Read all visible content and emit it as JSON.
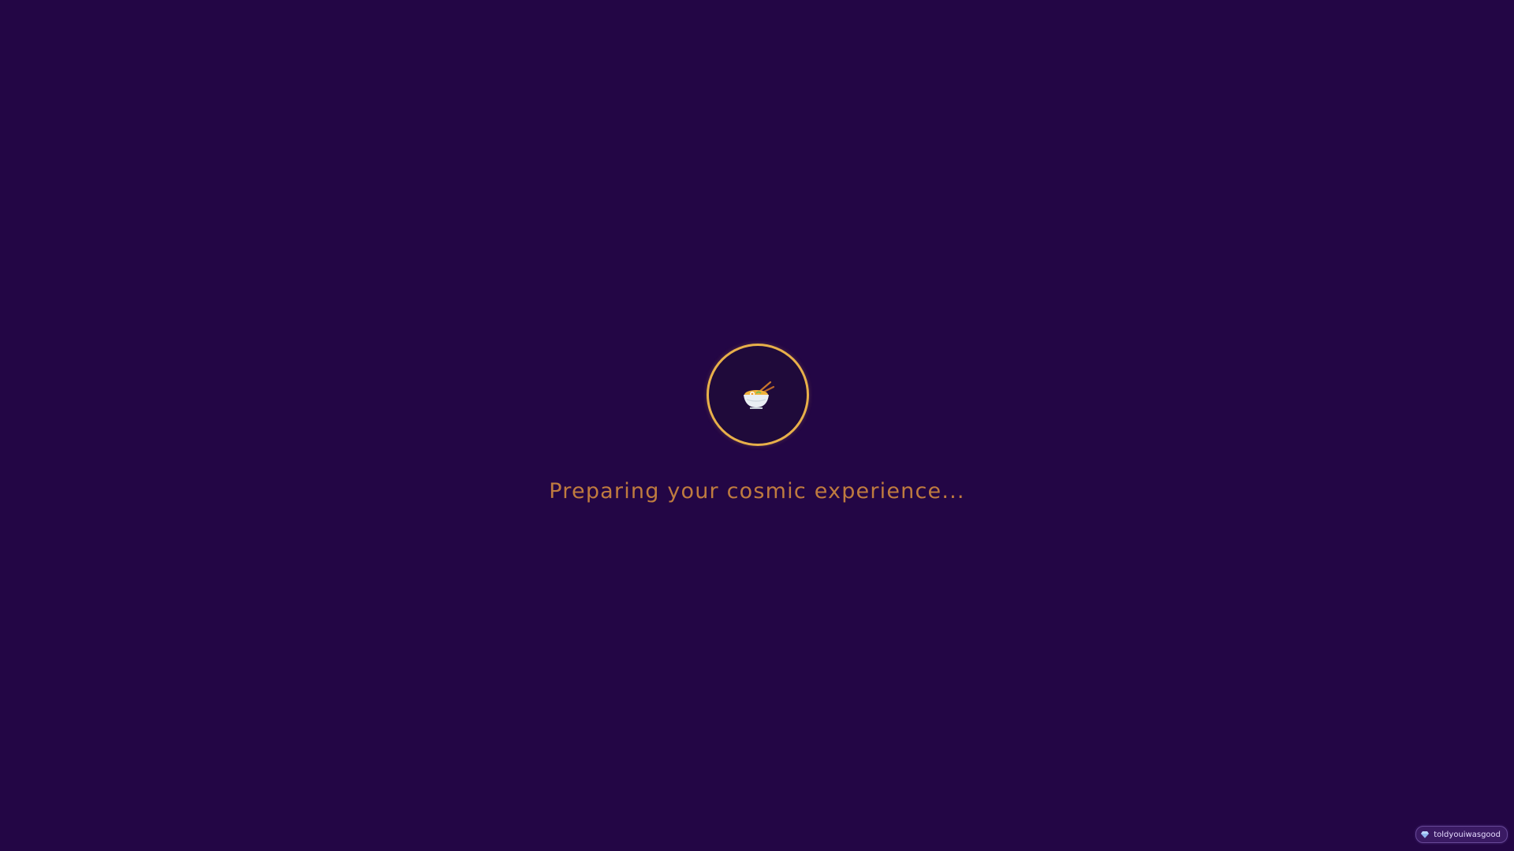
{
  "loader": {
    "icon": "ramen-bowl-icon",
    "ring_color": "#e8b04a",
    "message": "Preparing your cosmic experience..."
  },
  "badge": {
    "icon": "gem-icon",
    "label": "toldyouiwasgood"
  },
  "colors": {
    "background": "#230645",
    "text_accent": "#c8823f"
  }
}
